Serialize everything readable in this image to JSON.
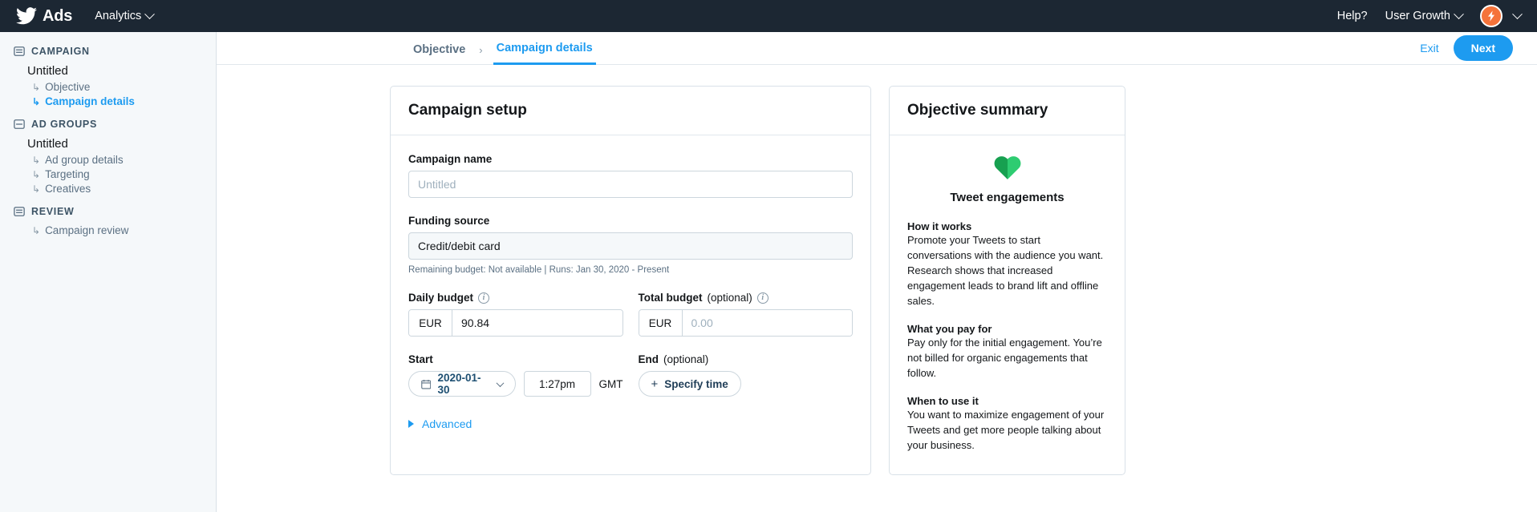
{
  "topnav": {
    "brand": "Ads",
    "bird_icon": "twitter-bird-icon",
    "analytics": "Analytics",
    "help": "Help?",
    "account": "User Growth",
    "avatar_icon": "lightning-bolt-avatar"
  },
  "sidebar": {
    "groups": [
      {
        "section": "CAMPAIGN",
        "entity": "Untitled",
        "items": [
          {
            "label": "Objective",
            "active": false
          },
          {
            "label": "Campaign details",
            "active": true
          }
        ]
      },
      {
        "section": "AD GROUPS",
        "entity": "Untitled",
        "items": [
          {
            "label": "Ad group details",
            "active": false
          },
          {
            "label": "Targeting",
            "active": false
          },
          {
            "label": "Creatives",
            "active": false
          }
        ]
      },
      {
        "section": "REVIEW",
        "entity": "",
        "items": [
          {
            "label": "Campaign review",
            "active": false
          }
        ]
      }
    ]
  },
  "breadcrumb": {
    "objective": "Objective",
    "separator": "›",
    "campaign_details": "Campaign details",
    "exit": "Exit",
    "next": "Next"
  },
  "setup": {
    "card_title": "Campaign setup",
    "name_label": "Campaign name",
    "name_value": "",
    "name_placeholder": "Untitled",
    "funding_label": "Funding source",
    "funding_value": "Credit/debit card",
    "funding_helper": "Remaining budget: Not available | Runs: Jan 30, 2020 - Present",
    "daily_budget_label": "Daily budget",
    "daily_budget_currency": "EUR",
    "daily_budget_value": "90.84",
    "total_budget_label": "Total budget",
    "total_budget_optional": "(optional)",
    "total_budget_currency": "EUR",
    "total_budget_value": "",
    "total_budget_placeholder": "0.00",
    "start_label": "Start",
    "start_date": "2020-01-30",
    "start_time": "1:27pm",
    "timezone": "GMT",
    "end_label": "End",
    "end_optional": "(optional)",
    "specify_time": "Specify time",
    "specify_plus": "+",
    "advanced": "Advanced"
  },
  "summary": {
    "card_title": "Objective summary",
    "heart_icon": "green-heart-icon",
    "objective_name": "Tweet engagements",
    "sections": [
      {
        "title": "How it works",
        "text": "Promote your Tweets to start conversations with the audience you want. Research shows that increased engagement leads to brand lift and offline sales."
      },
      {
        "title": "What you pay for",
        "text": "Pay only for the initial engagement. You’re not billed for organic engagements that follow."
      },
      {
        "title": "When to use it",
        "text": "You want to maximize engagement of your Tweets and get more people talking about your business."
      }
    ]
  },
  "colors": {
    "nav_bg": "#1c2733",
    "accent_blue": "#1d9bf0",
    "sidebar_bg": "#f5f8fa",
    "border": "#d9e1e8",
    "heart_green_dark": "#17a050",
    "heart_green_light": "#2ecc71",
    "avatar_orange": "#f5733a"
  }
}
